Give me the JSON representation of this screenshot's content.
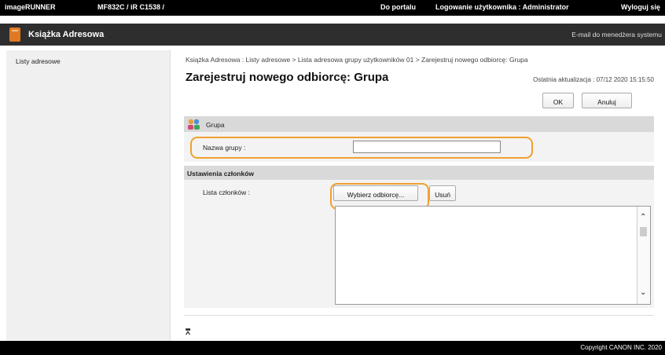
{
  "topbar": {
    "product": "imageRUNNER",
    "model": "MF832C / iR C1538 /",
    "portal_link": "Do portalu",
    "user_label": "Logowanie użytkownika : Administrator",
    "logout": "Wyloguj się"
  },
  "header": {
    "title": "Książka Adresowa",
    "email_admin": "E-mail do menedżera systemu"
  },
  "sidebar": {
    "items": [
      {
        "label": "Listy adresowe"
      }
    ]
  },
  "main": {
    "breadcrumb": "Książka Adresowa : Listy adresowe > Lista adresowa grupy użytkowników 01 > Zarejestruj nowego odbiorcę: Grupa",
    "page_title": "Zarejestruj nowego odbiorcę: Grupa",
    "last_updated": "Ostatnia aktualizacja : 07/12 2020 15:15:50",
    "ok_button": "OK",
    "cancel_button": "Anuluj",
    "group_section": {
      "title": "Grupa",
      "name_label": "Nazwa grupy :",
      "name_value": ""
    },
    "members_section": {
      "title": "Ustawienia członków",
      "list_label": "Lista członków :",
      "select_button": "Wybierz odbiorcę...",
      "delete_button": "Usuń"
    },
    "to_top_icon": "arrow-to-top"
  },
  "footer": {
    "copyright": "Copyright CANON INC. 2020"
  },
  "colors": {
    "highlight": "#f0a030",
    "header_bg": "#2e2e2e",
    "icon_orange": "#e07a22"
  }
}
